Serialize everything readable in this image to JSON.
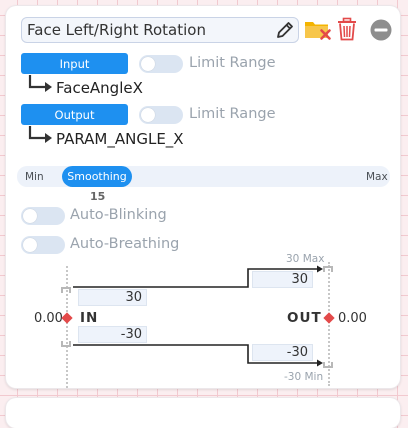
{
  "panel": {
    "title": "Face Left/Right Rotation",
    "input": {
      "button_label": "Input",
      "limit_label": "Limit Range",
      "param": "FaceAngleX"
    },
    "output": {
      "button_label": "Output",
      "limit_label": "Limit Range",
      "param": "PARAM_ANGLE_X"
    },
    "smoothing": {
      "min_label": "Min",
      "label": "Smoothing",
      "max_label": "Max",
      "value": "15"
    },
    "auto_blinking_label": "Auto-Blinking",
    "auto_breathing_label": "Auto-Breathing",
    "mapping": {
      "in_value": "0.00",
      "in_label": "IN",
      "out_label": "OUT",
      "out_value": "0.00",
      "in_max": "30",
      "in_min": "-30",
      "out_max_label": "30 Max",
      "out_max": "30",
      "out_min": "-30",
      "out_min_label": "-30 Min"
    }
  },
  "colors": {
    "accent": "#1e90f0",
    "toggle_off": "#dbe5f2",
    "delete": "#e34a4a",
    "folder": "#f4b400",
    "background_grid": "#f2c9cf"
  },
  "icons": [
    "pencil-icon",
    "folder-remove-icon",
    "trash-icon",
    "minus-circle-icon",
    "arrow-right-angle-icon"
  ]
}
